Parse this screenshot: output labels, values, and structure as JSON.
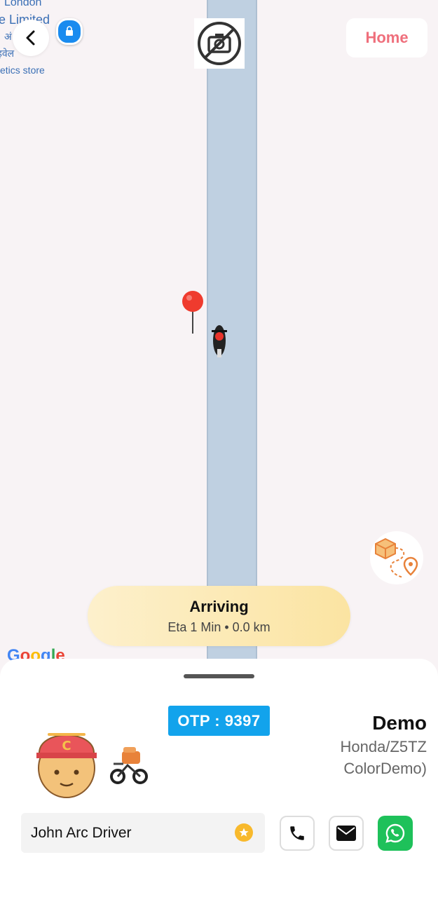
{
  "map": {
    "poi_lines": [
      "London",
      "e Limited",
      "अं",
      "इवेल",
      "etics store"
    ],
    "google_letters": [
      "G",
      "o",
      "o",
      "g",
      "l",
      "e"
    ],
    "google_colors": [
      "#4285f4",
      "#ea4335",
      "#fbbc05",
      "#4285f4",
      "#34a853",
      "#ea4335"
    ]
  },
  "header": {
    "back_icon": "chevron-left-icon",
    "camera_icon": "no-camera-icon",
    "home_label": "Home"
  },
  "status": {
    "title": "Arriving",
    "subtitle": "Eta 1 Min • 0.0 km"
  },
  "otp": {
    "label": "OTP : 9397"
  },
  "rider": {
    "name": "Demo",
    "vehicle_line1": "Honda/Z5TZ",
    "vehicle_line2": "ColorDemo)"
  },
  "driver": {
    "name": "John Arc Driver"
  },
  "colors": {
    "accent_home": "#ef6f7c",
    "otp_bg": "#12a3ec",
    "whatsapp": "#1ec15a",
    "star": "#f8b92c"
  }
}
